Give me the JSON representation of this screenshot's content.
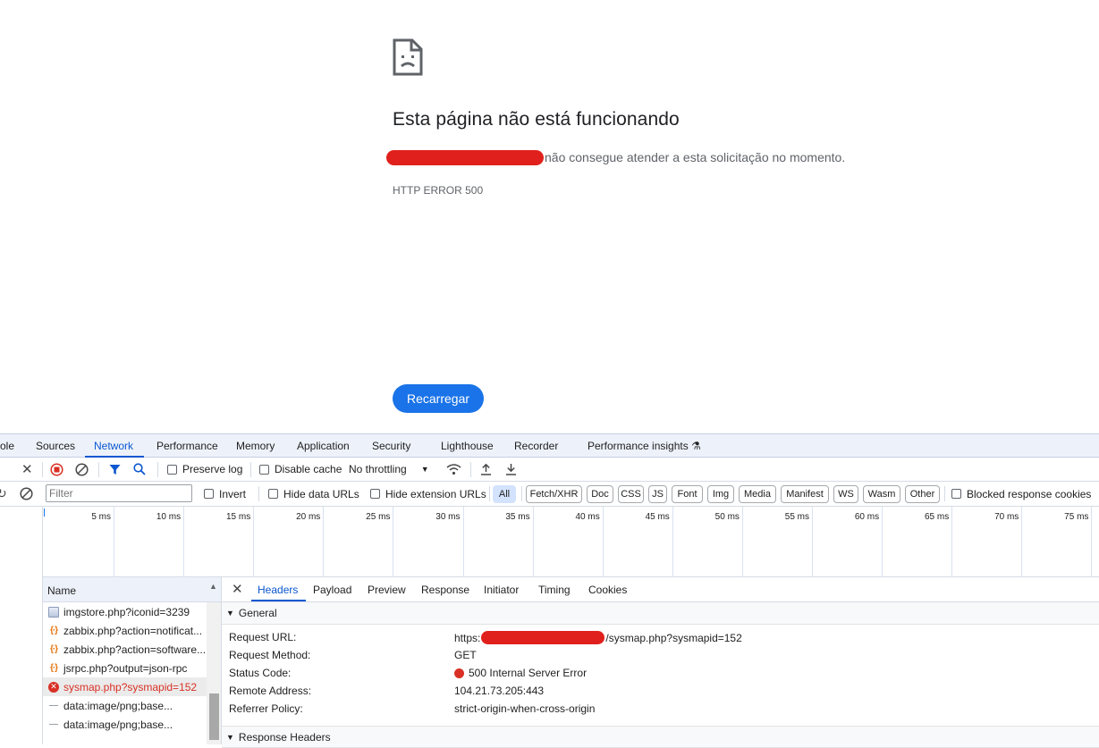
{
  "error_page": {
    "title": "Esta página não está funcionando",
    "description_suffix": "não consegue atender a esta solicitação no momento.",
    "error_code": "HTTP ERROR 500",
    "reload_label": "Recarregar",
    "accent": "#1a73e8"
  },
  "devtools": {
    "tabs": [
      {
        "label": "ole"
      },
      {
        "label": "Sources"
      },
      {
        "label": "Network",
        "active": true
      },
      {
        "label": "Performance"
      },
      {
        "label": "Memory"
      },
      {
        "label": "Application"
      },
      {
        "label": "Security"
      },
      {
        "label": "Lighthouse"
      },
      {
        "label": "Recorder"
      },
      {
        "label": "Performance insights"
      }
    ],
    "toolbar": {
      "preserve_log": "Preserve log",
      "disable_cache": "Disable cache",
      "throttling": "No throttling"
    },
    "filter_bar": {
      "filter_placeholder": "Filter",
      "invert": "Invert",
      "hide_data_urls": "Hide data URLs",
      "hide_extension_urls": "Hide extension URLs",
      "types": [
        "All",
        "Fetch/XHR",
        "Doc",
        "CSS",
        "JS",
        "Font",
        "Img",
        "Media",
        "Manifest",
        "WS",
        "Wasm",
        "Other"
      ],
      "active_type": "All",
      "blocked_cookies": "Blocked response cookies"
    },
    "timeline": {
      "ticks": [
        "5 ms",
        "10 ms",
        "15 ms",
        "20 ms",
        "25 ms",
        "30 ms",
        "35 ms",
        "40 ms",
        "45 ms",
        "50 ms",
        "55 ms",
        "60 ms",
        "65 ms",
        "70 ms",
        "75 ms"
      ]
    },
    "requests": {
      "column_name": "Name",
      "rows": [
        {
          "name": "imgstore.php?iconid=3239",
          "icon": "image-icon"
        },
        {
          "name": "zabbix.php?action=notificat...",
          "icon": "script-icon"
        },
        {
          "name": "zabbix.php?action=software...",
          "icon": "script-icon"
        },
        {
          "name": "jsrpc.php?output=json-rpc",
          "icon": "script-icon"
        },
        {
          "name": "sysmap.php?sysmapid=152",
          "icon": "error-icon",
          "selected": true
        },
        {
          "name": "data:image/png;base...",
          "icon": "data-icon"
        },
        {
          "name": "data:image/png;base...",
          "icon": "data-icon"
        }
      ]
    },
    "details": {
      "tabs": [
        "Headers",
        "Payload",
        "Preview",
        "Response",
        "Initiator",
        "Timing",
        "Cookies"
      ],
      "active_tab": "Headers",
      "general_label": "General",
      "general": [
        {
          "key": "Request URL:",
          "value_prefix": "https:",
          "value_suffix": "/sysmap.php?sysmapid=152"
        },
        {
          "key": "Request Method:",
          "value": "GET"
        },
        {
          "key": "Status Code:",
          "value": "500 Internal Server Error"
        },
        {
          "key": "Remote Address:",
          "value": "104.21.73.205:443"
        },
        {
          "key": "Referrer Policy:",
          "value": "strict-origin-when-cross-origin"
        }
      ],
      "response_headers_label": "Response Headers"
    }
  }
}
